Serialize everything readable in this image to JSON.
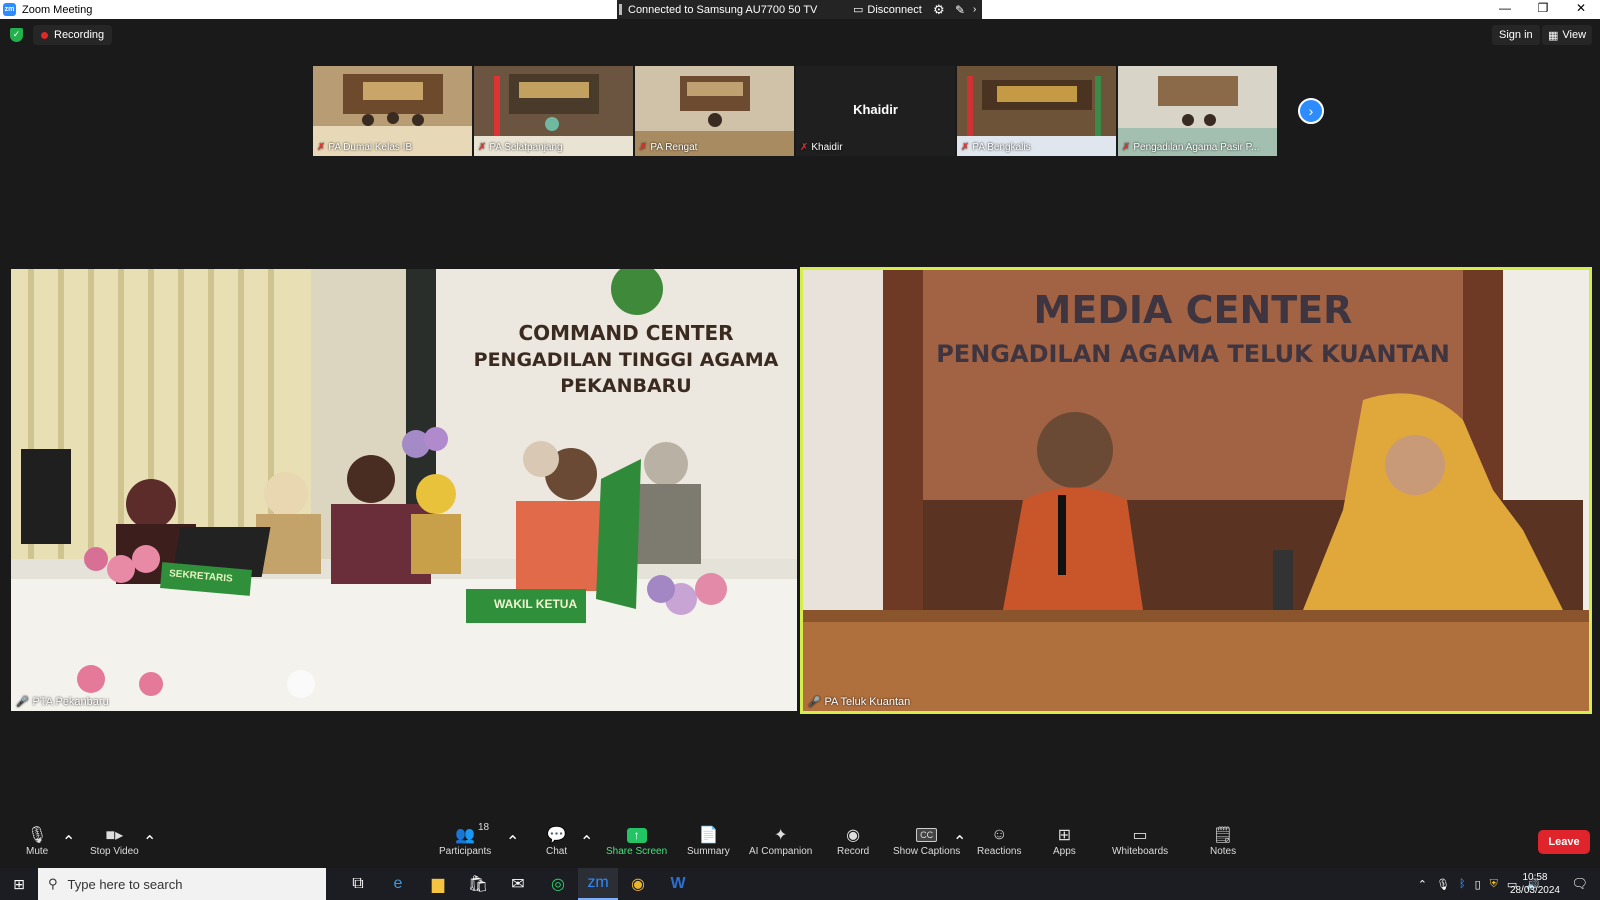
{
  "window": {
    "title": "Zoom Meeting"
  },
  "cast": {
    "status": "Connected to Samsung AU7700 50 TV",
    "disconnect_label": "Disconnect"
  },
  "topbar": {
    "recording_label": "Recording",
    "signin_label": "Sign in",
    "view_label": "View"
  },
  "thumbnails": [
    {
      "name": "PA Dumai Kelas IB"
    },
    {
      "name": "PA Selatpanjang"
    },
    {
      "name": "PA Rengat"
    },
    {
      "name": "Khaidir",
      "display_name": "Khaidir"
    },
    {
      "name": "PA Bengkalis"
    },
    {
      "name": "Pengadilan Agama Pasir P..."
    }
  ],
  "tiles": {
    "left": {
      "name": "PTA Pekanbaru",
      "sign_line1": "COMMAND CENTER",
      "sign_line2": "PENGADILAN TINGGI AGAMA",
      "sign_line3": "PEKANBARU",
      "plaque1": "SEKRETARIS",
      "plaque2": "WAKIL KETUA"
    },
    "right": {
      "name": "PA Teluk Kuantan",
      "sign_line1": "MEDIA CENTER",
      "sign_line2": "PENGADILAN AGAMA TELUK KUANTAN"
    }
  },
  "toolbar": {
    "mute": "Mute",
    "stop_video": "Stop Video",
    "participants": "Participants",
    "participants_count": "18",
    "chat": "Chat",
    "share_screen": "Share Screen",
    "summary": "Summary",
    "ai_companion": "AI Companion",
    "record": "Record",
    "show_captions": "Show Captions",
    "captions_badge": "CC",
    "reactions": "Reactions",
    "apps": "Apps",
    "whiteboards": "Whiteboards",
    "notes": "Notes",
    "leave": "Leave"
  },
  "taskbar": {
    "search_placeholder": "Type here to search",
    "time": "10:58",
    "date": "28/03/2024"
  },
  "colors": {
    "accent": "#2d8cff",
    "share_green": "#23c463",
    "leave_red": "#e0242b",
    "active_speaker": "#d5ed4d"
  }
}
